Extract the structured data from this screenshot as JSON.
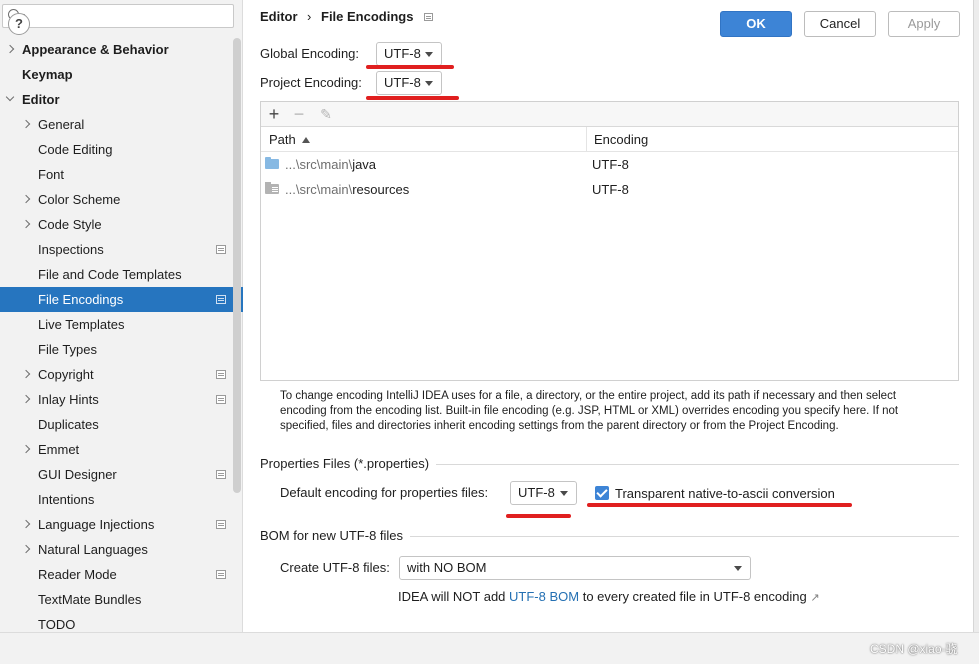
{
  "search": {
    "placeholder": ""
  },
  "sidebar": {
    "items": [
      {
        "label": "Appearance & Behavior",
        "chevron": "right",
        "bold": true,
        "settings_badge": false,
        "selected": false
      },
      {
        "label": "Keymap",
        "chevron": "none",
        "bold": true,
        "settings_badge": false,
        "selected": false
      },
      {
        "label": "Editor",
        "chevron": "down",
        "bold": true,
        "settings_badge": false,
        "selected": false
      },
      {
        "label": "General",
        "chevron": "right",
        "bold": false,
        "settings_badge": false,
        "selected": false
      },
      {
        "label": "Code Editing",
        "chevron": "none",
        "bold": false,
        "settings_badge": false,
        "selected": false
      },
      {
        "label": "Font",
        "chevron": "none",
        "bold": false,
        "settings_badge": false,
        "selected": false
      },
      {
        "label": "Color Scheme",
        "chevron": "right",
        "bold": false,
        "settings_badge": false,
        "selected": false
      },
      {
        "label": "Code Style",
        "chevron": "right",
        "bold": false,
        "settings_badge": false,
        "selected": false
      },
      {
        "label": "Inspections",
        "chevron": "none",
        "bold": false,
        "settings_badge": true,
        "selected": false
      },
      {
        "label": "File and Code Templates",
        "chevron": "none",
        "bold": false,
        "settings_badge": false,
        "selected": false
      },
      {
        "label": "File Encodings",
        "chevron": "none",
        "bold": false,
        "settings_badge": true,
        "selected": true
      },
      {
        "label": "Live Templates",
        "chevron": "none",
        "bold": false,
        "settings_badge": false,
        "selected": false
      },
      {
        "label": "File Types",
        "chevron": "none",
        "bold": false,
        "settings_badge": false,
        "selected": false
      },
      {
        "label": "Copyright",
        "chevron": "right",
        "bold": false,
        "settings_badge": true,
        "selected": false
      },
      {
        "label": "Inlay Hints",
        "chevron": "right",
        "bold": false,
        "settings_badge": true,
        "selected": false
      },
      {
        "label": "Duplicates",
        "chevron": "none",
        "bold": false,
        "settings_badge": false,
        "selected": false
      },
      {
        "label": "Emmet",
        "chevron": "right",
        "bold": false,
        "settings_badge": false,
        "selected": false
      },
      {
        "label": "GUI Designer",
        "chevron": "none",
        "bold": false,
        "settings_badge": true,
        "selected": false
      },
      {
        "label": "Intentions",
        "chevron": "none",
        "bold": false,
        "settings_badge": false,
        "selected": false
      },
      {
        "label": "Language Injections",
        "chevron": "right",
        "bold": false,
        "settings_badge": true,
        "selected": false
      },
      {
        "label": "Natural Languages",
        "chevron": "right",
        "bold": false,
        "settings_badge": false,
        "selected": false
      },
      {
        "label": "Reader Mode",
        "chevron": "none",
        "bold": false,
        "settings_badge": true,
        "selected": false
      },
      {
        "label": "TextMate Bundles",
        "chevron": "none",
        "bold": false,
        "settings_badge": false,
        "selected": false
      },
      {
        "label": "TODO",
        "chevron": "none",
        "bold": false,
        "settings_badge": false,
        "selected": false
      }
    ]
  },
  "header": {
    "crumb_parent": "Editor",
    "crumb_separator": "›",
    "crumb_current": "File Encodings",
    "back_icon": "←",
    "forward_icon": "→"
  },
  "encodings": {
    "global_label": "Global Encoding:",
    "global_value": "UTF-8",
    "project_label": "Project Encoding:",
    "project_value": "UTF-8"
  },
  "table": {
    "add_icon": "+",
    "remove_icon": "−",
    "edit_icon": "✎",
    "col_path": "Path",
    "col_encoding": "Encoding",
    "rows": [
      {
        "path_prefix": "...\\src\\main\\",
        "path_name": "java",
        "encoding": "UTF-8",
        "icon": "folder-icon"
      },
      {
        "path_prefix": "...\\src\\main\\",
        "path_name": "resources",
        "encoding": "UTF-8",
        "icon": "resources-folder-icon"
      }
    ]
  },
  "help_text": "To change encoding IntelliJ IDEA uses for a file, a directory, or the entire project, add its path if necessary and then select encoding from the encoding list. Built-in file encoding (e.g. JSP, HTML or XML) overrides encoding you specify here. If not specified, files and directories inherit encoding settings from the parent directory or from the Project Encoding.",
  "properties": {
    "section_title": "Properties Files (*.properties)",
    "default_label": "Default encoding for properties files:",
    "default_value": "UTF-8",
    "transparent_label": "Transparent native-to-ascii conversion",
    "transparent_checked": true
  },
  "bom": {
    "section_title": "BOM for new UTF-8 files",
    "create_label": "Create UTF-8 files:",
    "create_value": "with NO BOM",
    "note_prefix": "IDEA will NOT add ",
    "note_link": "UTF-8 BOM",
    "note_suffix": " to every created file in UTF-8 encoding",
    "note_ext_icon": "↗"
  },
  "footer": {
    "help_label": "?",
    "ok_label": "OK",
    "cancel_label": "Cancel",
    "apply_label": "Apply",
    "watermark": "CSDN @xiao-骁"
  },
  "colors": {
    "selection": "#2675bf",
    "annotation_red": "#e01f1f",
    "ok_button": "#3d84d6",
    "link": "#2470b3"
  }
}
